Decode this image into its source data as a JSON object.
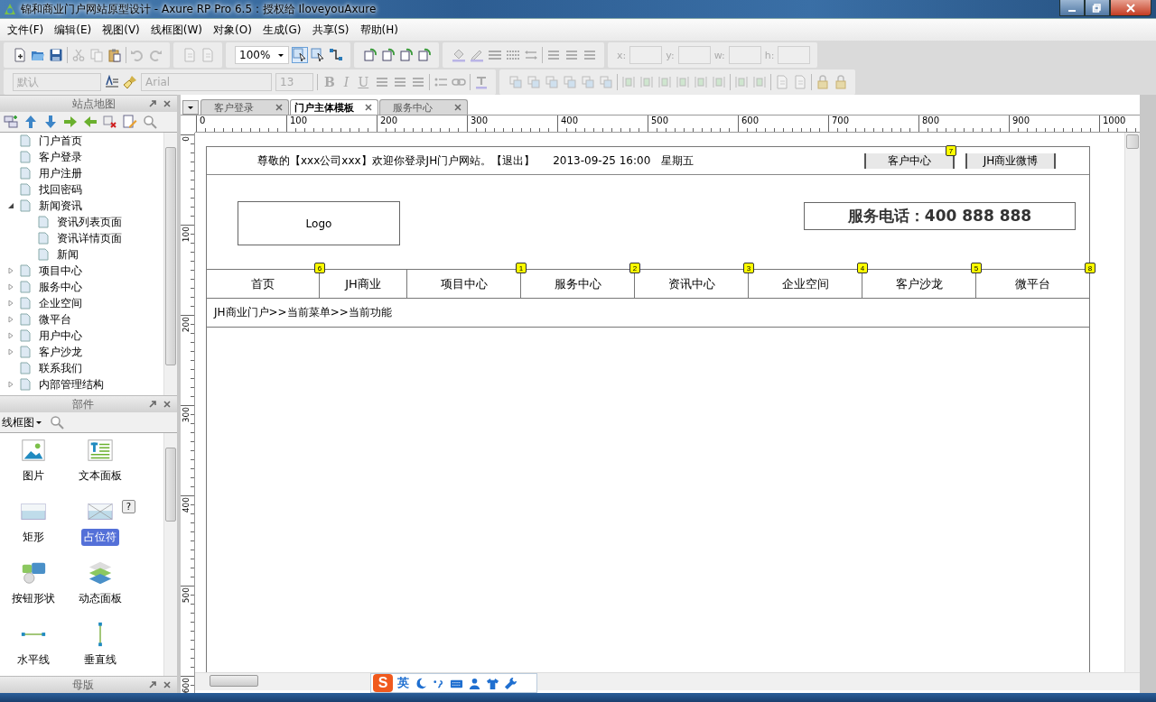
{
  "window": {
    "title": "锦和商业门户网站原型设计 - Axure RP Pro 6.5 : 授权给 IloveyouAxure"
  },
  "menu": [
    "文件(F)",
    "编辑(E)",
    "视图(V)",
    "线框图(W)",
    "对象(O)",
    "生成(G)",
    "共享(S)",
    "帮助(H)"
  ],
  "toolbar": {
    "zoom": "100%",
    "font_style": "默认",
    "font_family": "Arial",
    "font_size": "13",
    "format_buttons": [
      "B",
      "I",
      "U"
    ],
    "coords": [
      "x:",
      "y:",
      "w:",
      "h:"
    ]
  },
  "sitemap": {
    "title": "站点地图",
    "pages": [
      {
        "label": "门户首页"
      },
      {
        "label": "客户登录"
      },
      {
        "label": "用户注册"
      },
      {
        "label": "找回密码"
      },
      {
        "label": "新闻资讯",
        "expanded": true,
        "children": [
          {
            "label": "资讯列表页面"
          },
          {
            "label": "资讯详情页面"
          },
          {
            "label": "新闻"
          }
        ]
      },
      {
        "label": "项目中心",
        "expanded": false
      },
      {
        "label": "服务中心",
        "expanded": false
      },
      {
        "label": "企业空间",
        "expanded": false
      },
      {
        "label": "微平台",
        "expanded": false
      },
      {
        "label": "用户中心",
        "expanded": false
      },
      {
        "label": "客户沙龙",
        "expanded": false
      },
      {
        "label": "联系我们"
      },
      {
        "label": "内部管理结构",
        "expanded": false
      }
    ]
  },
  "widgets": {
    "title": "部件",
    "library": "线框图",
    "help": "?",
    "items": [
      {
        "label": "图片",
        "selected": false
      },
      {
        "label": "文本面板",
        "selected": false
      },
      {
        "label": "矩形",
        "selected": false
      },
      {
        "label": "占位符",
        "selected": true
      },
      {
        "label": "按钮形状",
        "selected": false
      },
      {
        "label": "动态面板",
        "selected": false
      },
      {
        "label": "水平线",
        "selected": false
      },
      {
        "label": "垂直线",
        "selected": false
      }
    ]
  },
  "masters": {
    "title": "母版"
  },
  "tabs": [
    {
      "label": "客户登录",
      "selected": false
    },
    {
      "label": "门户主体模板",
      "selected": true
    },
    {
      "label": "服务中心",
      "selected": false
    }
  ],
  "rulers": {
    "horizontal": [
      "0",
      "100",
      "200",
      "300",
      "400",
      "500",
      "600",
      "700",
      "800",
      "900",
      "1000"
    ],
    "vertical": [
      "0",
      "100",
      "200",
      "300",
      "400",
      "500",
      "600"
    ]
  },
  "page": {
    "top_bar": {
      "welcome": "尊敬的【xxx公司xxx】欢迎你登录JH门户网站。【退出】",
      "date": "2013-09-25 16:00",
      "weekday": "星期五",
      "buttons": [
        {
          "label": "客户中心",
          "badge": "7"
        },
        {
          "label": "JH商业微博"
        }
      ]
    },
    "logo": "Logo",
    "phone": "服务电话：400 888 888",
    "nav": [
      {
        "label": "首页",
        "badge": "6"
      },
      {
        "label": "JH商业"
      },
      {
        "label": "项目中心",
        "badge": "1"
      },
      {
        "label": "服务中心",
        "badge": "2"
      },
      {
        "label": "资讯中心",
        "badge": "3"
      },
      {
        "label": "企业空间",
        "badge": "4"
      },
      {
        "label": "客户沙龙",
        "badge": "5"
      },
      {
        "label": "微平台",
        "badge": "8"
      }
    ],
    "breadcrumb": "JH商业门户>>当前菜单>>当前功能"
  },
  "ime": {
    "logo": "S",
    "mode": "英"
  }
}
